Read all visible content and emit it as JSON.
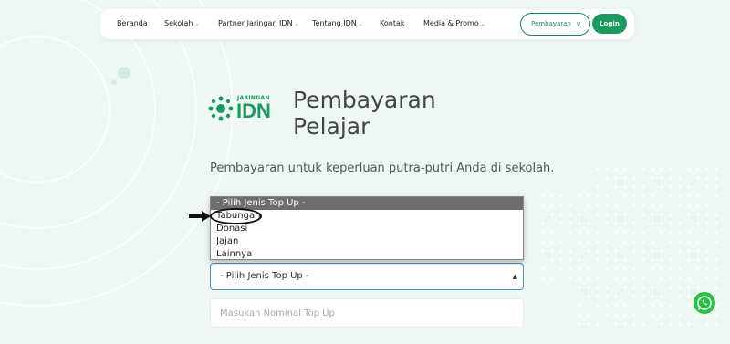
{
  "navbar": {
    "items": [
      {
        "label": "Beranda",
        "has_dropdown": false
      },
      {
        "label": "Sekolah",
        "has_dropdown": true
      },
      {
        "label": "Partner Jaringan IDN",
        "has_dropdown": true
      },
      {
        "label": "Tentang IDN",
        "has_dropdown": true
      },
      {
        "label": "Kontak",
        "has_dropdown": false
      },
      {
        "label": "Media & Promo",
        "has_dropdown": true
      }
    ],
    "pembayaran_label": "Pembayaran",
    "login_label": "Login"
  },
  "logo": {
    "small_text": "JARINGAN",
    "big_text": "IDN"
  },
  "hero": {
    "title_line1": "Pembayaran",
    "title_line2": "Pelajar",
    "subtitle": "Pembayaran untuk keperluan putra-putri Anda di sekolah."
  },
  "topup_dropdown": {
    "options": [
      "- Pilih Jenis Top Up -",
      "Tabungan",
      "Donasi",
      "Jajan",
      "Lainnya"
    ],
    "highlighted": "- Pilih Jenis Top Up -",
    "annotated_option": "Tabungan"
  },
  "topup_select": {
    "value": "- Pilih Jenis Top Up -"
  },
  "nominal_input": {
    "placeholder": "Masukan Nominal Top Up",
    "value": ""
  },
  "colors": {
    "brand_green": "#1a9a5c",
    "background": "#eef8f2",
    "whatsapp_green": "#25c243"
  },
  "icons": [
    "chevron-down-icon",
    "idn-logo-icon",
    "arrow-right-icon",
    "whatsapp-icon"
  ]
}
